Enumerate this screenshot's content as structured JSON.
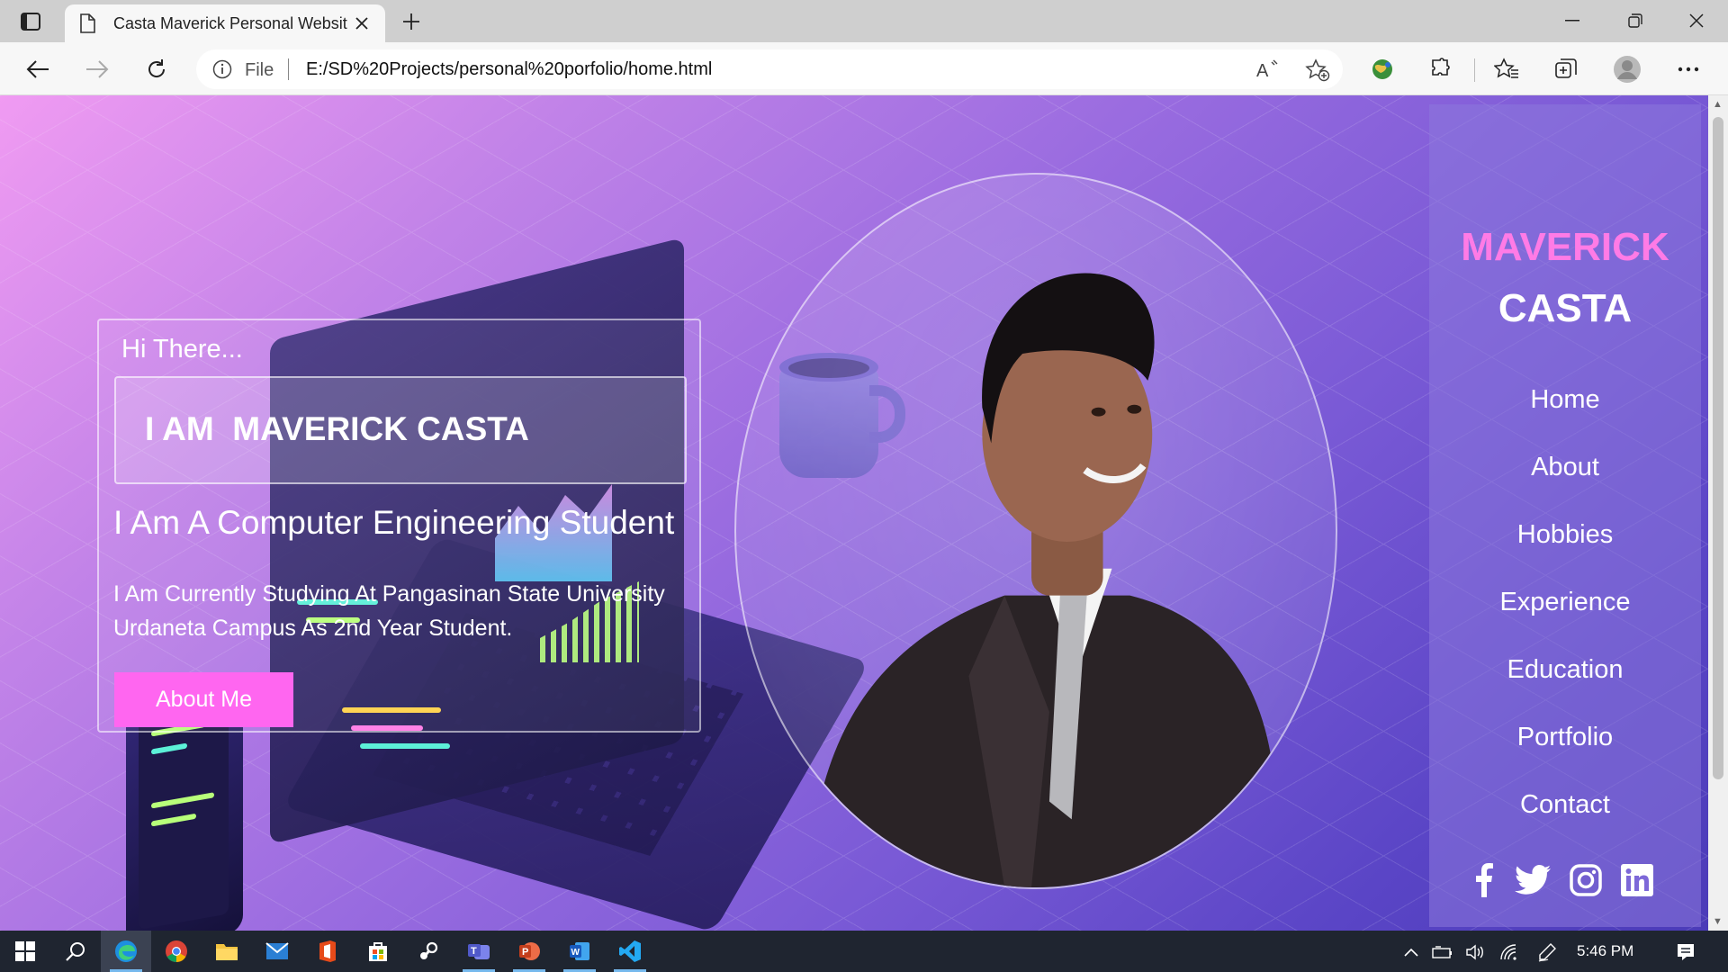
{
  "browser": {
    "tab_title": "Casta Maverick Personal Website",
    "address_prefix": "File",
    "url": "E:/SD%20Projects/personal%20porfolio/home.html"
  },
  "hero": {
    "greeting": "Hi There...",
    "name_line": "I AM  MAVERICK CASTA",
    "role": "I Am A Computer Engineering Student",
    "description": "I Am Currently Studying At Pangasinan State University Urdaneta Campus As 2nd Year Student.",
    "button_label": "About Me"
  },
  "sidebar": {
    "brand_first": "MAVERICK",
    "brand_last": "CASTA",
    "nav": [
      "Home",
      "About",
      "Hobbies",
      "Experience",
      "Education",
      "Portfolio",
      "Contact"
    ],
    "social": [
      "facebook-icon",
      "twitter-icon",
      "instagram-icon",
      "linkedin-icon"
    ]
  },
  "taskbar": {
    "time": "5:46 PM"
  },
  "colors": {
    "accent_pink": "#ff66f0",
    "brand_pink": "#ff7be6",
    "gradient_start": "#f09bf2",
    "gradient_end": "#4b3bb8"
  }
}
